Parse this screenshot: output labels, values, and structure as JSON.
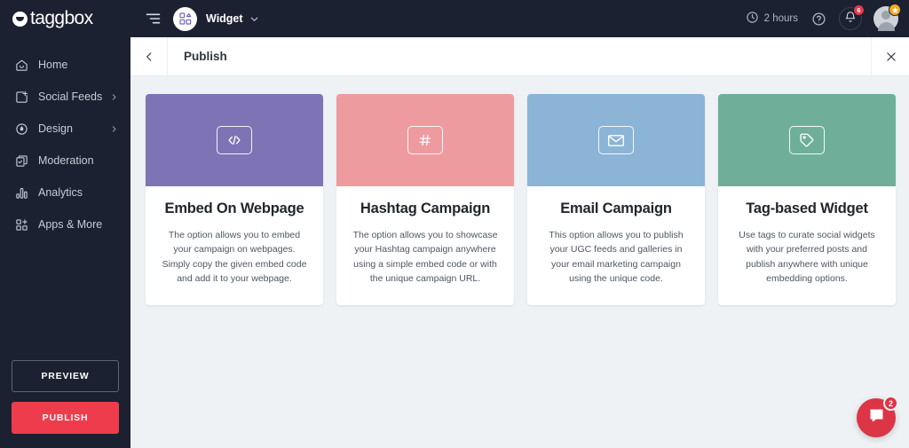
{
  "brand": {
    "logo_text": "taggbox",
    "sidebar_bg": "#1b2130",
    "publish_color": "#ef3c4c"
  },
  "sidebar": {
    "items": [
      {
        "label": "Home",
        "icon": "home-icon",
        "has_chevron": false
      },
      {
        "label": "Social Feeds",
        "icon": "feed-add-icon",
        "has_chevron": true
      },
      {
        "label": "Design",
        "icon": "design-drop-icon",
        "has_chevron": true
      },
      {
        "label": "Moderation",
        "icon": "moderation-icon",
        "has_chevron": false
      },
      {
        "label": "Analytics",
        "icon": "analytics-bars-icon",
        "has_chevron": false
      },
      {
        "label": "Apps & More",
        "icon": "apps-grid-icon",
        "has_chevron": false
      }
    ],
    "preview_label": "PREVIEW",
    "publish_label": "PUBLISH"
  },
  "topbar": {
    "collapse_icon": "collapse-menu-icon",
    "widget_icon": "widget-blocks-icon",
    "widget_name": "Widget",
    "caret_icon": "chevron-down-icon",
    "hours_icon": "clock-icon",
    "hours_label": "2 hours",
    "help_icon": "help-circle-icon",
    "bell_icon": "bell-icon",
    "bell_badge": "6",
    "avatar_icon": "user-avatar",
    "avatar_badge_icon": "star-icon"
  },
  "pageheader": {
    "back_icon": "chevron-left-icon",
    "title": "Publish",
    "close_icon": "close-icon"
  },
  "cards": [
    {
      "title": "Embed On Webpage",
      "desc": "The option allows you to embed your campaign on webpages. Simply copy the given embed code and add it to your webpage.",
      "color": "#7e73b5",
      "icon": "code-icon"
    },
    {
      "title": "Hashtag Campaign",
      "desc": "The option allows you to showcase your Hashtag campaign anywhere using a simple embed code or with the unique campaign URL.",
      "color": "#ee9b9f",
      "icon": "hashtag-icon"
    },
    {
      "title": "Email Campaign",
      "desc": "This option allows you to publish your UGC feeds and galleries in your email marketing campaign using the unique code.",
      "color": "#8bb4d7",
      "icon": "envelope-icon"
    },
    {
      "title": "Tag-based Widget",
      "desc": "Use tags to curate social widgets with your preferred posts and publish anywhere with unique embedding options.",
      "color": "#6faf9a",
      "icon": "tag-icon"
    }
  ],
  "intercom": {
    "icon": "chat-bubble-icon",
    "badge": "2"
  }
}
